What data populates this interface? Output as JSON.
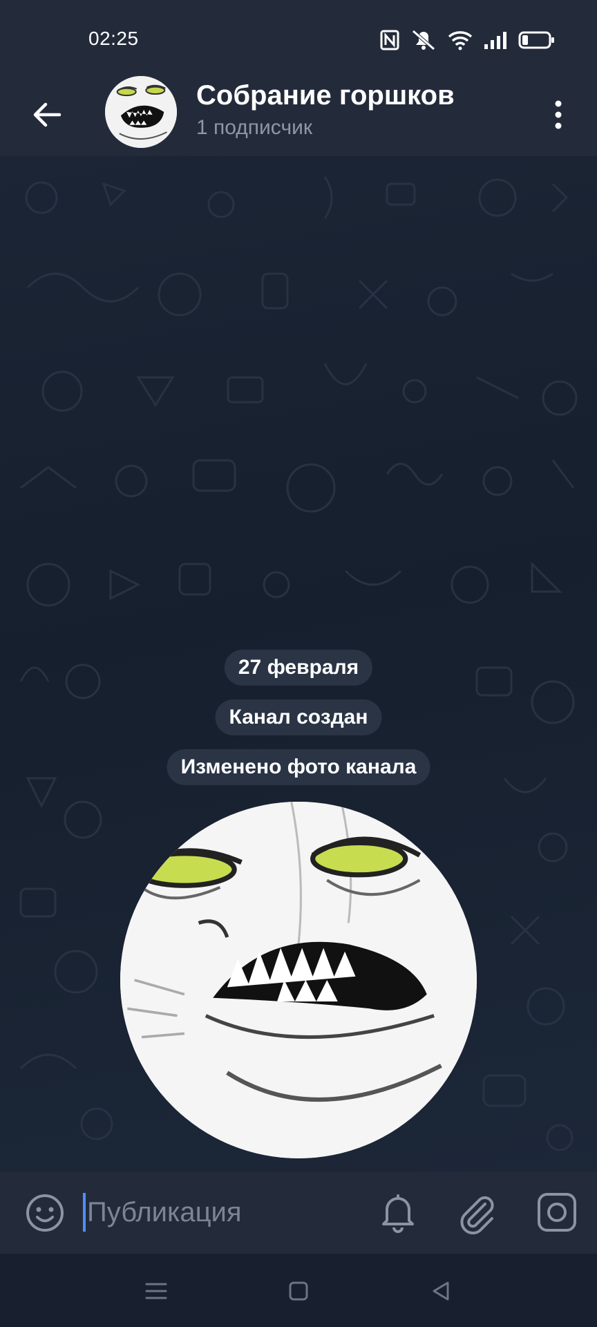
{
  "status_bar": {
    "time": "02:25"
  },
  "header": {
    "title": "Собрание горшков",
    "subtitle": "1 подписчик"
  },
  "chat": {
    "date_label": "27 февраля",
    "service_messages": [
      "Канал создан",
      "Изменено фото канала"
    ]
  },
  "input": {
    "placeholder": "Публикация",
    "value": ""
  },
  "icons": {
    "back": "arrow-left-icon",
    "menu": "more-vertical-icon",
    "emoji": "smile-icon",
    "bell": "bell-icon",
    "attach": "paperclip-icon",
    "camera": "instagram-camera-icon"
  },
  "colors": {
    "header_bg": "#232b3b",
    "chat_bg": "#1a2230",
    "accent": "#4f8ef7",
    "muted_text": "#8d97a6"
  }
}
